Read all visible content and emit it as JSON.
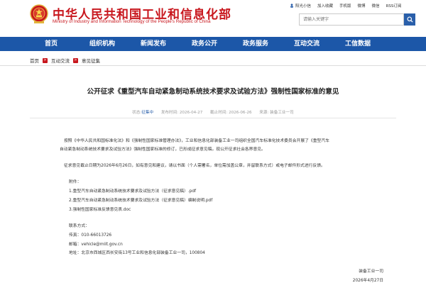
{
  "header": {
    "site_title": "中华人民共和国工业和信息化部",
    "site_subtitle": "Ministry of Industry and Information Technology of the People's Republic of China",
    "top_links": [
      "阳光小信",
      "加入收藏",
      "手机版",
      "微博",
      "微信",
      "RSS订阅"
    ],
    "search_placeholder": "请输入关键字"
  },
  "nav": {
    "items": [
      "首页",
      "组织机构",
      "新闻发布",
      "政务公开",
      "政务服务",
      "互动交流",
      "工信数据"
    ]
  },
  "breadcrumb": [
    "首页",
    "互动交流",
    "意见征集"
  ],
  "article": {
    "title": "公开征求《重型汽车自动紧急制动系统技术要求及试验方法》强制性国家标准的意见",
    "meta": {
      "status_label": "状态:",
      "status_value": "征集中",
      "start_label": "发布时间:",
      "start_date": "2026-04-27",
      "end_label": "截止时间:",
      "end_date": "2026-06-26",
      "dept_label": "来源:",
      "dept": "装备工业一司"
    },
    "paragraphs": [
      "按照《中华人民共和国标准化法》和《强制性国家标准管理办法》，工业和信息化部装备工业一司组织全国汽车标准化技术委员会开展了《重型汽车",
      "自动紧急制动系统技术要求及试验方法》强制性国家标准的修订，已形成征求意见稿，现公开征求社会各界意见。",
      "征求意见截止日期为2026年6月26日，如有意见和建议，请以书面（个人需署名，单位需加盖公章，并留联系方式）或电子邮件形式进行反馈。"
    ],
    "attachments_label": "附件：",
    "attachments": [
      "1.重型汽车自动紧急制动系统技术要求及试验方法（征求意见稿）.pdf",
      "2.重型汽车自动紧急制动系统技术要求及试验方法（征求意见稿）编制说明.pdf",
      "3.强制性国家标准反馈意见表.doc"
    ],
    "contact_label": "联系方式：",
    "fax_label": "传真：",
    "fax": "010-66013726",
    "email_label": "邮箱：",
    "email": "vehicle@miit.gov.cn",
    "address_label": "地址：",
    "address": "北京市西城区西长安街13号工业和信息化部装备工业一司，100804",
    "sign_dept": "装备工业一司",
    "sign_date": "2026年4月27日"
  },
  "colors": {
    "brand_red": "#c8161d",
    "nav_blue": "#1c57a8"
  }
}
